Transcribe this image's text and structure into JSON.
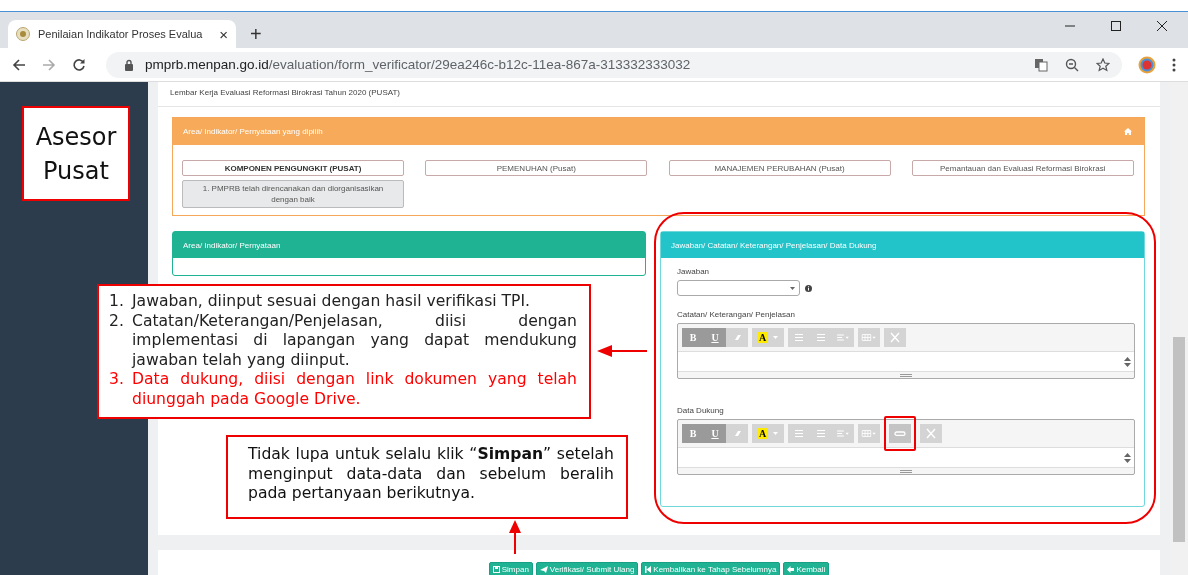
{
  "browser": {
    "tab_title": "Penilaian Indikator Proses Evalua",
    "tab_close": "×",
    "new_tab": "+",
    "url_domain": "pmprb.menpan.go.id",
    "url_path": "/evaluation/form_verificator/29ea246c-b12c-11ea-867a-313332333032"
  },
  "page_title": "Lembar Kerja Evaluasi Reformasi Birokrasi Tahun 2020 (PUSAT)",
  "selected_panel": {
    "title": "Area/ Indikator/ Pernyataan yang dipilih",
    "areas": [
      {
        "label": "KOMPONEN PENGUNGKIT (PUSAT)",
        "selected": true
      },
      {
        "label": "PEMENUHAN (Pusat)",
        "selected": false
      },
      {
        "label": "MANAJEMEN PERUBAHAN (Pusat)",
        "selected": false
      },
      {
        "label": "Pemantauan dan Evaluasi Reformasi Birokrasi",
        "selected": false
      }
    ],
    "sub_items": [
      "1. PMPRB telah direncanakan dan diorganisasikan dengan baik"
    ]
  },
  "statement_panel": {
    "title": "Area/ Indikator/ Pernyataan"
  },
  "answer_panel": {
    "title": "Jawaban/ Catatan/ Keterangan/ Penjelasan/ Data Dukung",
    "answer_label": "Jawaban",
    "editors": [
      {
        "label": "Catatan/ Keterangan/ Penjelasan",
        "groups": [
          [
            {
              "kind": "letter",
              "label": "B"
            },
            {
              "kind": "letter",
              "label": "U"
            },
            {
              "kind": "eraser"
            }
          ],
          [
            {
              "kind": "color",
              "label": "A"
            }
          ],
          [
            {
              "kind": "ul"
            },
            {
              "kind": "ol"
            },
            {
              "kind": "align"
            }
          ],
          [
            {
              "kind": "table"
            }
          ],
          [
            {
              "kind": "fullscreen"
            }
          ]
        ]
      },
      {
        "label": "Data Dukung",
        "groups": [
          [
            {
              "kind": "letter",
              "label": "B"
            },
            {
              "kind": "letter",
              "label": "U"
            },
            {
              "kind": "eraser"
            }
          ],
          [
            {
              "kind": "color",
              "label": "A"
            }
          ],
          [
            {
              "kind": "ul"
            },
            {
              "kind": "ol"
            },
            {
              "kind": "align"
            }
          ],
          [
            {
              "kind": "table"
            }
          ],
          [
            {
              "kind": "link",
              "highlighted": true
            }
          ],
          [
            {
              "kind": "fullscreen"
            }
          ]
        ]
      }
    ]
  },
  "buttons": [
    {
      "kind": "save",
      "label": "Simpan"
    },
    {
      "kind": "send",
      "label": "Verifikasi/ Submit Ulang"
    },
    {
      "kind": "first",
      "label": "Kembalikan ke Tahap Sebelumnya"
    },
    {
      "kind": "back",
      "label": "Kembali"
    }
  ],
  "annotations": {
    "role_lines": [
      "Asesor",
      "Pusat"
    ],
    "notes": [
      {
        "number": "1.",
        "text": "Jawaban, diinput sesuai dengan hasil verifikasi TPI.",
        "color": "#222222"
      },
      {
        "number": "2.",
        "text": "Catatan/Keterangan/Penjelasan, diisi dengan implementasi di lapangan yang dapat mendukung jawaban telah yang diinput.",
        "color": "#222222"
      },
      {
        "number": "3.",
        "text": "Data dukung, diisi dengan link dokumen yang telah diunggah pada Google Drive.",
        "color": "#ff0000"
      }
    ],
    "reminder": "Tidak lupa untuk selalu klik “**Simpan**” setelah menginput data-data dan sebelum beralih pada pertanyaan berikutnya."
  }
}
